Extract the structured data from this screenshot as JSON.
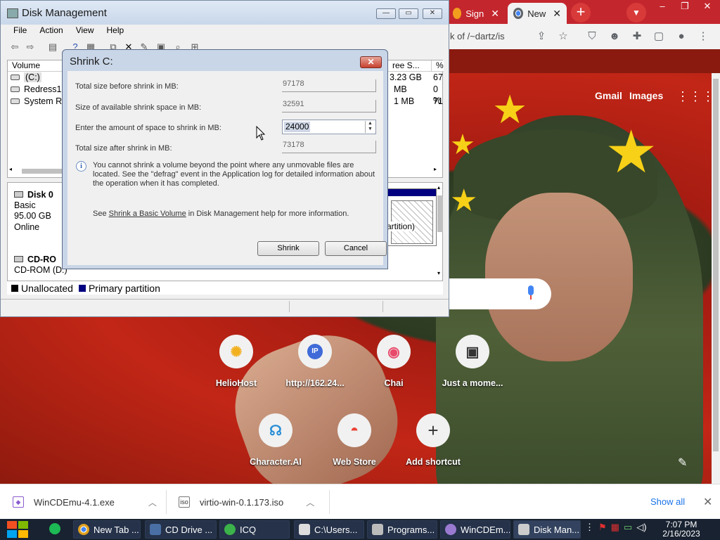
{
  "chrome": {
    "tabs": [
      {
        "label": "Sign",
        "icon": "sun-icon",
        "active": false
      },
      {
        "label": "New",
        "icon": "chrome-icon",
        "active": true
      }
    ],
    "omnibox_text": "k of /~dartz/is",
    "new_tab_label": "+",
    "top_links": {
      "gmail": "Gmail",
      "images": "Images"
    },
    "shortcuts": [
      {
        "label": "HelioHost",
        "glyph": "✺"
      },
      {
        "label": "http://162.24...",
        "glyph": "IP"
      },
      {
        "label": "Chai",
        "glyph": "◉"
      },
      {
        "label": "Just a mome...",
        "glyph": "▣"
      },
      {
        "label": "Character.AI",
        "glyph": "☊"
      },
      {
        "label": "Web Store",
        "glyph": "◓"
      },
      {
        "label": "Add shortcut",
        "glyph": "+"
      }
    ]
  },
  "disk_mgmt": {
    "title": "Disk Management",
    "menu": [
      "File",
      "Action",
      "View",
      "Help"
    ],
    "list_headers": {
      "volume": "Volume",
      "free_space": "ree S...",
      "percent": "%"
    },
    "volumes": [
      {
        "name": "(C:)",
        "free": "3.23 GB",
        "pct": "67"
      },
      {
        "name": "Redress10",
        "free": "MB",
        "pct": "0 %"
      },
      {
        "name": "System Re",
        "free": "1 MB",
        "pct": "71"
      }
    ],
    "disk0": {
      "name": "Disk 0",
      "type": "Basic",
      "size": "95.00 GB",
      "status": "Online",
      "partition_text": "artition)"
    },
    "cdrom": {
      "name": "CD-RO",
      "sub": "CD-ROM (D:)"
    },
    "legend": [
      {
        "label": "Unallocated",
        "color": "#000000"
      },
      {
        "label": "Primary partition",
        "color": "#000080"
      }
    ]
  },
  "shrink_dialog": {
    "title": "Shrink C:",
    "close_label": "✕",
    "fields": [
      {
        "label": "Total size before shrink in MB:",
        "value": "97178"
      },
      {
        "label": "Size of available shrink space in MB:",
        "value": "32591"
      },
      {
        "label": "Enter the amount of space to shrink in MB:",
        "value": "24000"
      },
      {
        "label": "Total size after shrink in MB:",
        "value": "73178"
      }
    ],
    "info_text": "You cannot shrink a volume beyond the point where any unmovable files are located. See the \"defrag\" event in the Application log for detailed information about the operation when it has completed.",
    "help_prefix": "See ",
    "help_link": "Shrink a Basic Volume",
    "help_suffix": " in Disk Management help for more information.",
    "buttons": {
      "shrink": "Shrink",
      "cancel": "Cancel"
    }
  },
  "downloads": {
    "items": [
      {
        "name": "WinCDEmu-4.1.exe"
      },
      {
        "name": "virtio-win-0.1.173.iso"
      }
    ],
    "show_all": "Show all"
  },
  "taskbar": {
    "items": [
      {
        "label": "New Tab ...",
        "color": "#e0a020"
      },
      {
        "label": "CD Drive ...",
        "color": "#4a6fa5"
      },
      {
        "label": "ICQ",
        "color": "#3bb24a"
      },
      {
        "label": "C:\\Users...",
        "color": "#dddddd"
      },
      {
        "label": "Programs...",
        "color": "#bbbbbb"
      },
      {
        "label": "WinCDEm...",
        "color": "#9a7ad0"
      },
      {
        "label": "Disk Man...",
        "color": "#cccccc"
      }
    ],
    "time": "7:07 PM",
    "date": "2/16/2023"
  }
}
